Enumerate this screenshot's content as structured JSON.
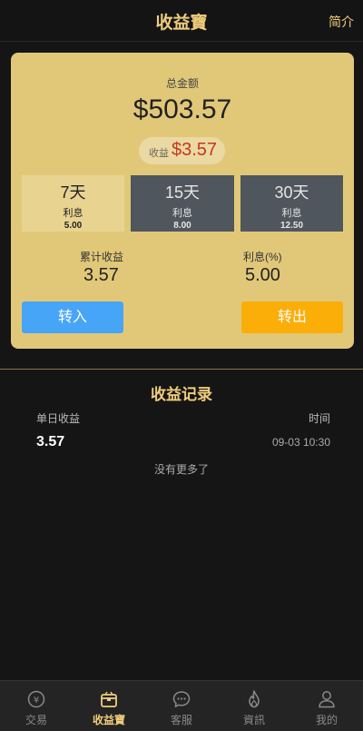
{
  "header": {
    "title": "收益寶",
    "intro": "简介"
  },
  "summary": {
    "total_label": "总金额",
    "total_value": "$503.57",
    "earnings_label": "收益",
    "earnings_value": "$3.57"
  },
  "terms": [
    {
      "days": "7天",
      "label": "利息",
      "rate": "5.00",
      "selected": true
    },
    {
      "days": "15天",
      "label": "利息",
      "rate": "8.00",
      "selected": false
    },
    {
      "days": "30天",
      "label": "利息",
      "rate": "12.50",
      "selected": false
    }
  ],
  "stats": {
    "cumulative_label": "累计收益",
    "cumulative_value": "3.57",
    "interest_label": "利息(%)",
    "interest_value": "5.00"
  },
  "buttons": {
    "transfer_in": "转入",
    "transfer_out": "转出"
  },
  "records": {
    "title": "收益记录",
    "col_daily": "单日收益",
    "col_time": "时间",
    "rows": [
      {
        "amount": "3.57",
        "time": "09-03 10:30"
      }
    ],
    "no_more": "没有更多了"
  },
  "nav": {
    "items": [
      {
        "label": "交易",
        "icon": "yen-coin-icon",
        "active": false
      },
      {
        "label": "收益寶",
        "icon": "treasure-box-icon",
        "active": true
      },
      {
        "label": "客服",
        "icon": "chat-bubble-icon",
        "active": false
      },
      {
        "label": "資訊",
        "icon": "flame-icon",
        "active": false
      },
      {
        "label": "我的",
        "icon": "user-icon",
        "active": false
      }
    ]
  },
  "colors": {
    "accent_gold": "#f0cd7d",
    "card": "#e1c879",
    "earnings_red": "#c8361f",
    "btn_in": "#47a5f8",
    "btn_out": "#fbad08"
  }
}
